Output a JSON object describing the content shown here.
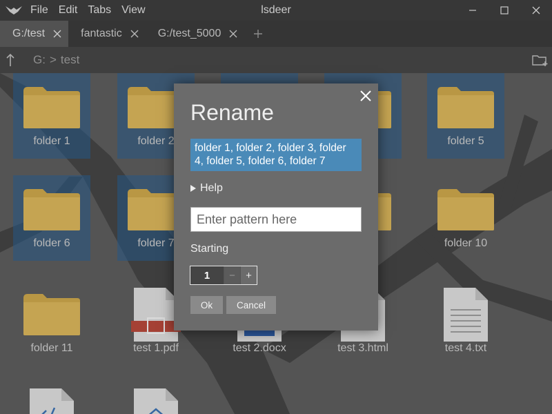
{
  "window": {
    "title": "lsdeer",
    "menu": [
      "File",
      "Edit",
      "Tabs",
      "View"
    ]
  },
  "tabs": [
    {
      "label": "G:/test",
      "active": true
    },
    {
      "label": "fantastic",
      "active": false
    },
    {
      "label": "G:/test_5000",
      "active": false
    }
  ],
  "path": {
    "segments": [
      "G:",
      ">",
      "test"
    ]
  },
  "items": [
    {
      "name": "folder 1",
      "type": "folder",
      "selected": true
    },
    {
      "name": "folder 2",
      "type": "folder",
      "selected": true
    },
    {
      "name": "folder 5",
      "type": "folder",
      "selected": true
    },
    {
      "name": "folder 6",
      "type": "folder",
      "selected": true
    },
    {
      "name": "folder 7",
      "type": "folder",
      "selected": true
    },
    {
      "name": "folder 10",
      "type": "folder",
      "selected": false
    },
    {
      "name": "folder 11",
      "type": "folder",
      "selected": false
    },
    {
      "name": "test 1.pdf",
      "type": "pdf",
      "selected": false
    },
    {
      "name": "test 2.docx",
      "type": "docx",
      "selected": false
    },
    {
      "name": "test 3.html",
      "type": "html",
      "selected": false
    },
    {
      "name": "test 4.txt",
      "type": "txt",
      "selected": false
    }
  ],
  "dialog": {
    "title": "Rename",
    "selection_text": "folder 1, folder 2, folder 3, folder 4, folder 5, folder 6, folder 7",
    "help_label": "Help",
    "pattern_placeholder": "Enter pattern here",
    "pattern_value": "",
    "starting_label": "Starting",
    "starting_value": "1",
    "minus_label": "−",
    "plus_label": "+",
    "ok_label": "Ok",
    "cancel_label": "Cancel"
  },
  "colors": {
    "selection_blue": "#4a8ab8",
    "folder_yellow": "#c9a44a",
    "dialog_bg": "#6b6b6b"
  }
}
